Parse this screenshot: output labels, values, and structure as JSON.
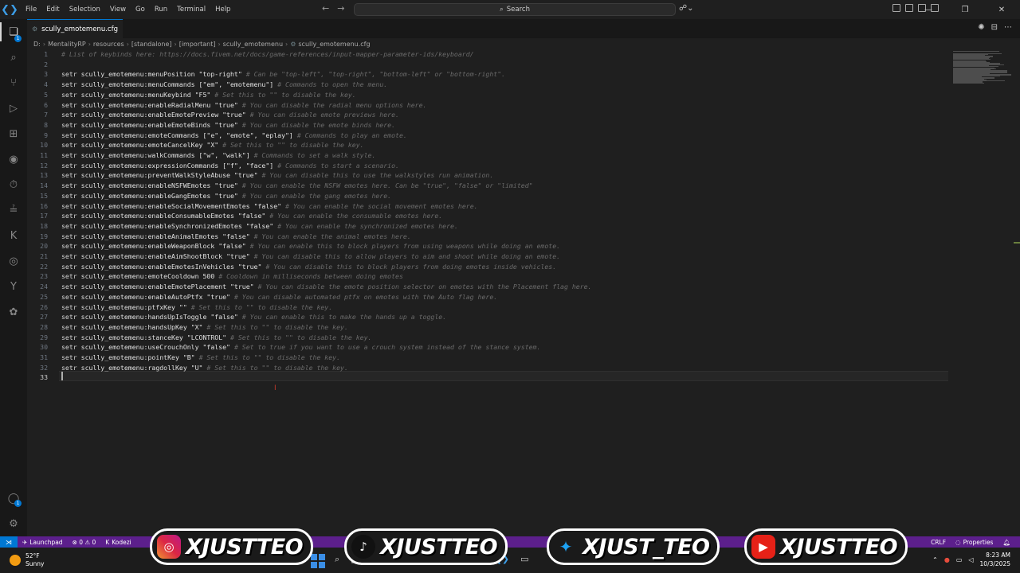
{
  "titlebar": {
    "menus": [
      "File",
      "Edit",
      "Selection",
      "View",
      "Go",
      "Run",
      "Terminal",
      "Help"
    ],
    "search_label": "Search"
  },
  "tab": {
    "label": "scully_emotemenu.cfg"
  },
  "breadcrumb": [
    "D:",
    "MentalityRP",
    "resources",
    "[standalone]",
    "[important]",
    "scully_emotemenu",
    "scully_emotemenu.cfg"
  ],
  "editor": {
    "current_line": 33,
    "lines": [
      {
        "n": "1",
        "kw": "",
        "key": "",
        "val": "",
        "cmt": "# List of keybinds here: https://docs.fivem.net/docs/game-references/input-mapper-parameter-ids/keyboard/"
      },
      {
        "n": "2",
        "kw": "",
        "key": "",
        "val": "",
        "cmt": ""
      },
      {
        "n": "3",
        "kw": "setr",
        "key": "scully_emotemenu:menuPosition",
        "val": "\"top-right\"",
        "cmt": "# Can be \"top-left\", \"top-right\", \"bottom-left\" or \"bottom-right\"."
      },
      {
        "n": "4",
        "kw": "setr",
        "key": "scully_emotemenu:menuCommands",
        "val": "[\"em\", \"emotemenu\"]",
        "cmt": "# Commands to open the menu."
      },
      {
        "n": "5",
        "kw": "setr",
        "key": "scully_emotemenu:menuKeybind",
        "val": "\"F5\"",
        "cmt": "# Set this to \"\" to disable the key."
      },
      {
        "n": "6",
        "kw": "setr",
        "key": "scully_emotemenu:enableRadialMenu",
        "val": "\"true\"",
        "cmt": "# You can disable the radial menu options here."
      },
      {
        "n": "7",
        "kw": "setr",
        "key": "scully_emotemenu:enableEmotePreview",
        "val": "\"true\"",
        "cmt": "# You can disable emote previews here."
      },
      {
        "n": "8",
        "kw": "setr",
        "key": "scully_emotemenu:enableEmoteBinds",
        "val": "\"true\"",
        "cmt": "# You can disable the emote binds here."
      },
      {
        "n": "9",
        "kw": "setr",
        "key": "scully_emotemenu:emoteCommands",
        "val": "[\"e\", \"emote\", \"eplay\"]",
        "cmt": "# Commands to play an emote."
      },
      {
        "n": "10",
        "kw": "setr",
        "key": "scully_emotemenu:emoteCancelKey",
        "val": "\"X\"",
        "cmt": "# Set this to \"\" to disable the key."
      },
      {
        "n": "11",
        "kw": "setr",
        "key": "scully_emotemenu:walkCommands",
        "val": "[\"w\", \"walk\"]",
        "cmt": "# Commands to set a walk style."
      },
      {
        "n": "12",
        "kw": "setr",
        "key": "scully_emotemenu:expressionCommands",
        "val": "[\"f\", \"face\"]",
        "cmt": "# Commands to start a scenario."
      },
      {
        "n": "13",
        "kw": "setr",
        "key": "scully_emotemenu:preventWalkStyleAbuse",
        "val": "\"true\"",
        "cmt": "# You can disable this to use the walkstyles run animation."
      },
      {
        "n": "14",
        "kw": "setr",
        "key": "scully_emotemenu:enableNSFWEmotes",
        "val": "\"true\"",
        "cmt": "# You can enable the NSFW emotes here. Can be \"true\", \"false\" or \"limited\""
      },
      {
        "n": "15",
        "kw": "setr",
        "key": "scully_emotemenu:enableGangEmotes",
        "val": "\"true\"",
        "cmt": "# You can enable the gang emotes here."
      },
      {
        "n": "16",
        "kw": "setr",
        "key": "scully_emotemenu:enableSocialMovementEmotes",
        "val": "\"false\"",
        "cmt": "# You can enable the social movement emotes here."
      },
      {
        "n": "17",
        "kw": "setr",
        "key": "scully_emotemenu:enableConsumableEmotes",
        "val": "\"false\"",
        "cmt": "# You can enable the consumable emotes here."
      },
      {
        "n": "18",
        "kw": "setr",
        "key": "scully_emotemenu:enableSynchronizedEmotes",
        "val": "\"false\"",
        "cmt": "# You can enable the synchronized emotes here."
      },
      {
        "n": "19",
        "kw": "setr",
        "key": "scully_emotemenu:enableAnimalEmotes",
        "val": "\"false\"",
        "cmt": "# You can enable the animal emotes here."
      },
      {
        "n": "20",
        "kw": "setr",
        "key": "scully_emotemenu:enableWeaponBlock",
        "val": "\"false\"",
        "cmt": "# You can enable this to block players from using weapons while doing an emote."
      },
      {
        "n": "21",
        "kw": "setr",
        "key": "scully_emotemenu:enableAimShootBlock",
        "val": "\"true\"",
        "cmt": "# You can disable this to allow players to aim and shoot while doing an emote."
      },
      {
        "n": "22",
        "kw": "setr",
        "key": "scully_emotemenu:enableEmotesInVehicles",
        "val": "\"true\"",
        "cmt": "# You can disable this to block players from doing emotes inside vehicles."
      },
      {
        "n": "23",
        "kw": "setr",
        "key": "scully_emotemenu:emoteCooldown",
        "val": "500",
        "cmt": "# Cooldown in milliseconds between doing emotes"
      },
      {
        "n": "24",
        "kw": "setr",
        "key": "scully_emotemenu:enableEmotePlacement",
        "val": "\"true\"",
        "cmt": "# You can disable the emote position selector on emotes with the Placement flag here."
      },
      {
        "n": "25",
        "kw": "setr",
        "key": "scully_emotemenu:enableAutoPtfx",
        "val": "\"true\"",
        "cmt": "# You can disable automated ptfx on emotes with the Auto flag here."
      },
      {
        "n": "26",
        "kw": "setr",
        "key": "scully_emotemenu:ptfxKey",
        "val": "\"\"",
        "cmt": "# Set this to \"\" to disable the key."
      },
      {
        "n": "27",
        "kw": "setr",
        "key": "scully_emotemenu:handsUpIsToggle",
        "val": "\"false\"",
        "cmt": "# You can enable this to make the hands up a toggle."
      },
      {
        "n": "28",
        "kw": "setr",
        "key": "scully_emotemenu:handsUpKey",
        "val": "\"X\"",
        "cmt": "# Set this to \"\" to disable the key."
      },
      {
        "n": "29",
        "kw": "setr",
        "key": "scully_emotemenu:stanceKey",
        "val": "\"LCONTROL\"",
        "cmt": "# Set this to \"\" to disable the key."
      },
      {
        "n": "30",
        "kw": "setr",
        "key": "scully_emotemenu:useCrouchOnly",
        "val": "\"false\"",
        "cmt": "# Set to true if you want to use a crouch system instead of the stance system."
      },
      {
        "n": "31",
        "kw": "setr",
        "key": "scully_emotemenu:pointKey",
        "val": "\"B\"",
        "cmt": "# Set this to \"\" to disable the key."
      },
      {
        "n": "32",
        "kw": "setr",
        "key": "scully_emotemenu:ragdollKey",
        "val": "\"U\"",
        "cmt": "# Set this to \"\" to disable the key."
      },
      {
        "n": "33",
        "kw": "",
        "key": "",
        "val": "",
        "cmt": ""
      }
    ]
  },
  "statusbar": {
    "launchpad": "Launchpad",
    "problems": "⊗ 0 ⚠ 0",
    "kodezi": "Kodezi",
    "eol": "CRLF",
    "properties": "Properties"
  },
  "social": [
    {
      "icon": "instagram-icon",
      "glyph": "◎",
      "color": "#d6249f",
      "handle": "XJUSTTEO"
    },
    {
      "icon": "tiktok-icon",
      "glyph": "♪",
      "color": "#000000",
      "handle": "XJUSTTEO"
    },
    {
      "icon": "twitter-icon",
      "glyph": "✦",
      "color": "#1da1f2",
      "handle": "XJUST_TEO"
    },
    {
      "icon": "youtube-icon",
      "glyph": "▶",
      "color": "#e62117",
      "handle": "XJUSTTEO"
    }
  ],
  "taskbar": {
    "temp": "52°F",
    "condition": "Sunny",
    "time": "8:23 AM",
    "date": "10/3/2025"
  }
}
